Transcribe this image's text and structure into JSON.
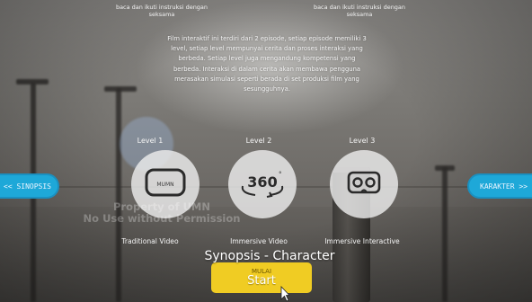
{
  "notes": {
    "left": "baca dan ikuti instruksi dengan seksama",
    "right": "baca dan ikuti instruksi dengan seksama"
  },
  "description": "Film interaktif ini terdiri dari 2 episode, setiap episode memiliki 3 level, setiap level mempunyai cerita dan proses interaksi yang berbeda. Setiap level juga mengandung kompetensi yang berbeda. Interaksi di dalam cerita akan membawa pengguna merasakan simulasi seperti berada di set produksi film yang sesungguhnya.",
  "levels": [
    {
      "title": "Level 1",
      "icon": "tv-icon",
      "icon_text": "MUMN",
      "caption": "Traditional Video"
    },
    {
      "title": "Level 2",
      "icon": "360-icon",
      "icon_text": "360",
      "caption": "Immersive Video"
    },
    {
      "title": "Level 3",
      "icon": "vr-headset-icon",
      "icon_text": "",
      "caption": "Immersive Interactive"
    }
  ],
  "nav": {
    "left_label": "<< SINOPSIS",
    "right_label": "KARAKTER >>"
  },
  "watermark": {
    "line1": "Property of UMN",
    "line2": "No Use without Permission"
  },
  "mode_label": "Synopsis - Character",
  "start": {
    "sub_label": "MULAI",
    "label": "Start"
  },
  "colors": {
    "nav_pill": "#1ea8d8",
    "start_button": "#f0cc23",
    "circle": "#ebebeb"
  }
}
